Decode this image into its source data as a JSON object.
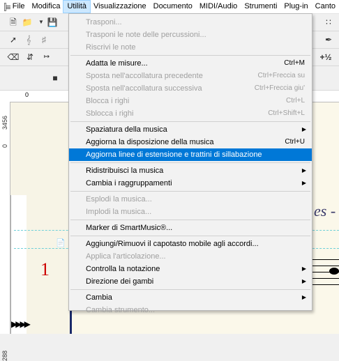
{
  "menubar": {
    "items": [
      {
        "label": "File"
      },
      {
        "label": "Modifica"
      },
      {
        "label": "Utilità"
      },
      {
        "label": "Visualizzazione"
      },
      {
        "label": "Documento"
      },
      {
        "label": "MIDI/Audio"
      },
      {
        "label": "Strumenti"
      },
      {
        "label": "Plug-in"
      },
      {
        "label": "Canto"
      }
    ]
  },
  "ruler": {
    "top_mark": "0",
    "left_marks": [
      "3456",
      "0",
      "288"
    ]
  },
  "score": {
    "measure_number": "1",
    "title_fragment": "es -"
  },
  "menu": {
    "items": [
      {
        "label": "Trasponi...",
        "shortcut": ""
      },
      {
        "label": "Trasponi le note delle percussioni...",
        "shortcut": ""
      },
      {
        "label": "Riscrivi le note",
        "shortcut": ""
      },
      {
        "label": "Adatta le misure...",
        "shortcut": "Ctrl+M"
      },
      {
        "label": "Sposta nell'accollatura precedente",
        "shortcut": "Ctrl+Freccia su"
      },
      {
        "label": "Sposta nell'accollatura successiva",
        "shortcut": "Ctrl+Freccia giu'"
      },
      {
        "label": "Blocca i righi",
        "shortcut": "Ctrl+L"
      },
      {
        "label": "Sblocca i righi",
        "shortcut": "Ctrl+Shift+L"
      },
      {
        "label": "Spaziatura della musica",
        "shortcut": ""
      },
      {
        "label": "Aggiorna la disposizione della musica",
        "shortcut": "Ctrl+U"
      },
      {
        "label": "Aggiorna linee di estensione e trattini di sillabazione",
        "shortcut": ""
      },
      {
        "label": "Ridistribuisci la musica",
        "shortcut": ""
      },
      {
        "label": "Cambia i raggruppamenti",
        "shortcut": ""
      },
      {
        "label": "Esplodi la musica...",
        "shortcut": ""
      },
      {
        "label": "Implodi la musica...",
        "shortcut": ""
      },
      {
        "label": "Marker di SmartMusic®...",
        "shortcut": ""
      },
      {
        "label": "Aggiungi/Rimuovi il capotasto mobile agli accordi...",
        "shortcut": ""
      },
      {
        "label": "Applica l'articolazione...",
        "shortcut": ""
      },
      {
        "label": "Controlla la notazione",
        "shortcut": ""
      },
      {
        "label": "Direzione dei gambi",
        "shortcut": ""
      },
      {
        "label": "Cambia",
        "shortcut": ""
      },
      {
        "label": "Cambia strumento...",
        "shortcut": ""
      }
    ]
  }
}
